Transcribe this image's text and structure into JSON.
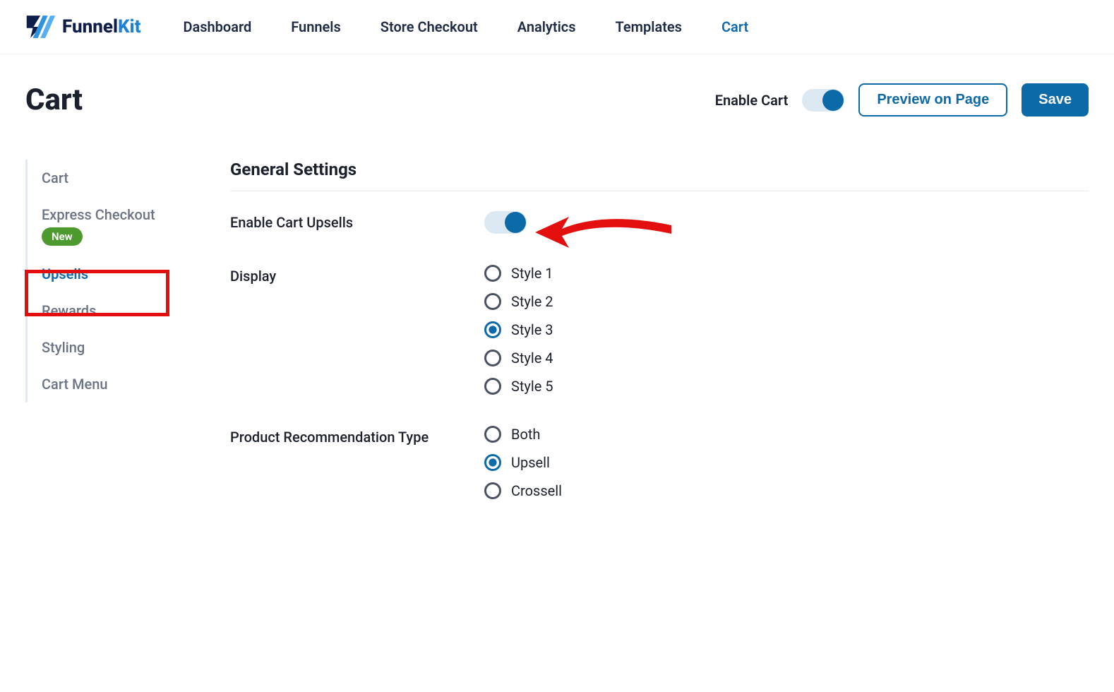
{
  "brand": {
    "name1": "Funnel",
    "name2": "Kit"
  },
  "nav": {
    "items": [
      {
        "label": "Dashboard"
      },
      {
        "label": "Funnels"
      },
      {
        "label": "Store Checkout"
      },
      {
        "label": "Analytics"
      },
      {
        "label": "Templates"
      },
      {
        "label": "Cart"
      }
    ]
  },
  "header": {
    "title": "Cart",
    "enable_label": "Enable Cart",
    "preview_label": "Preview on Page",
    "save_label": "Save"
  },
  "sidebar": {
    "items": [
      {
        "label": "Cart"
      },
      {
        "label": "Express Checkout",
        "badge": "New"
      },
      {
        "label": "Upsells"
      },
      {
        "label": "Rewards"
      },
      {
        "label": "Styling"
      },
      {
        "label": "Cart Menu"
      }
    ]
  },
  "settings": {
    "section_title": "General Settings",
    "enable_upsells_label": "Enable Cart Upsells",
    "display_label": "Display",
    "display_options": [
      {
        "label": "Style 1"
      },
      {
        "label": "Style 2"
      },
      {
        "label": "Style 3"
      },
      {
        "label": "Style 4"
      },
      {
        "label": "Style 5"
      }
    ],
    "rec_type_label": "Product Recommendation Type",
    "rec_type_options": [
      {
        "label": "Both"
      },
      {
        "label": "Upsell"
      },
      {
        "label": "Crossell"
      }
    ]
  }
}
